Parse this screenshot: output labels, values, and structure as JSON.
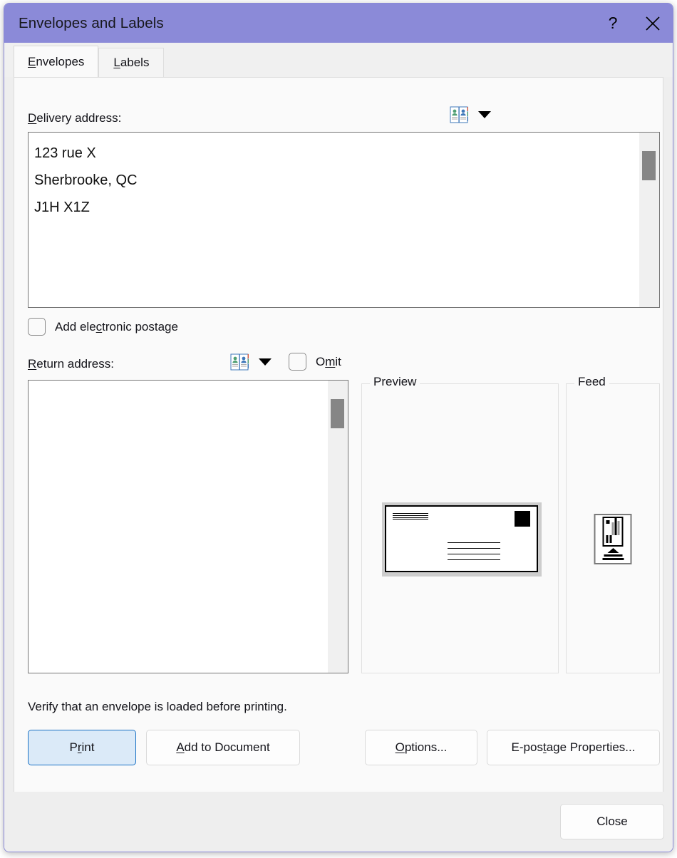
{
  "window": {
    "title": "Envelopes and Labels",
    "help_icon": "question-mark-icon",
    "close_icon": "close-icon",
    "accent_color": "#8b8ad8"
  },
  "tabs": [
    {
      "label": "Envelopes",
      "accelerator": "E",
      "active": true
    },
    {
      "label": "Labels",
      "accelerator": "L",
      "active": false
    }
  ],
  "delivery": {
    "label_before": "D",
    "label_after": "elivery address:",
    "address_book_icon": "address-book-icon",
    "dropdown_icon": "chevron-down-icon",
    "value": "123 rue X\nSherbrooke, QC\nJ1H X1Z",
    "placeholder": ""
  },
  "postage": {
    "label_a": "Add ele",
    "label_accel": "c",
    "label_b": "tronic postage",
    "checked": false
  },
  "return": {
    "label_before": "R",
    "label_after": "eturn address:",
    "address_book_icon": "address-book-icon",
    "dropdown_icon": "chevron-down-icon",
    "value": "",
    "placeholder": "",
    "omit_a": "O",
    "omit_accel": "m",
    "omit_b": "it",
    "omit_checked": false
  },
  "preview": {
    "legend": "Preview"
  },
  "feed": {
    "legend": "Feed"
  },
  "verify_text": "Verify that an envelope is loaded before printing.",
  "buttons": {
    "print": {
      "a": "P",
      "accel": "r",
      "b": "int",
      "default": true
    },
    "add_to_document": {
      "a": "",
      "accel": "A",
      "b": "dd to Document"
    },
    "options": {
      "a": "",
      "accel": "O",
      "b": "ptions..."
    },
    "epostage": {
      "a": "E-pos",
      "accel": "t",
      "b": "age Properties..."
    },
    "close": {
      "label": "Close"
    }
  }
}
